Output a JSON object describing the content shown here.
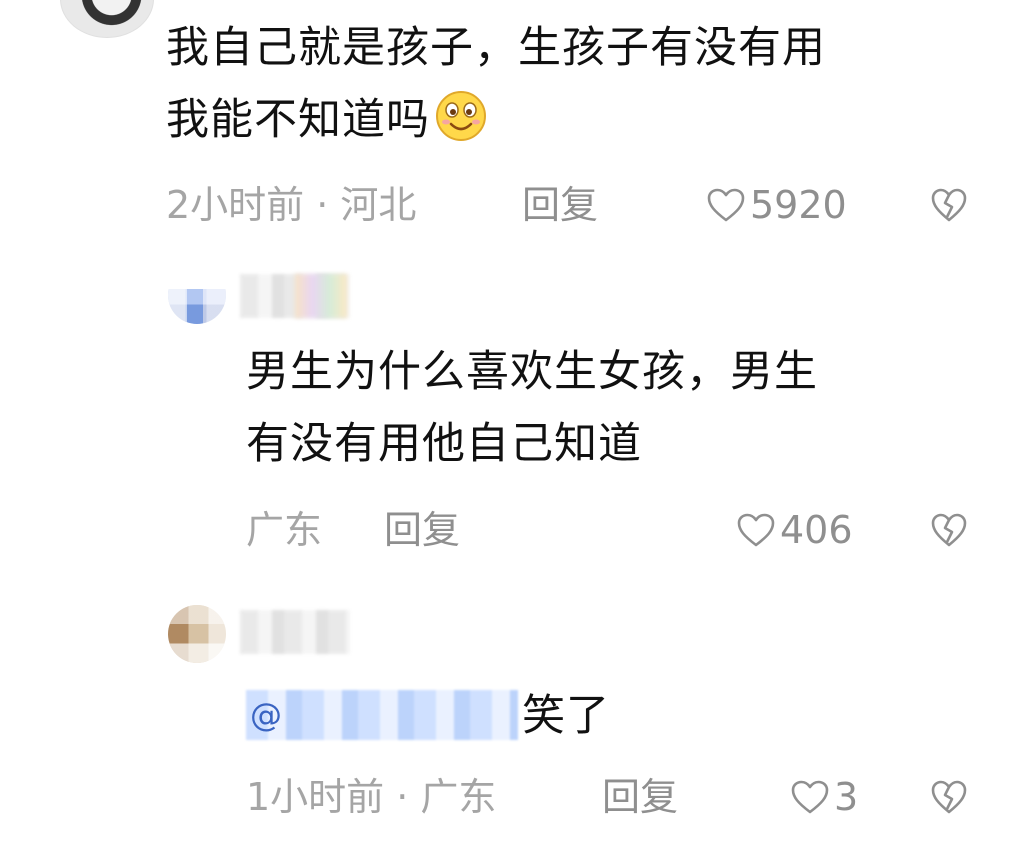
{
  "main_comment": {
    "text_line1": "我自己就是孩子，生孩子有没有用",
    "text_line2": "我能不知道吗",
    "emoji": "smile-emoji",
    "meta": "2小时前 · 河北",
    "reply_label": "回复",
    "likes": "5920"
  },
  "reply1": {
    "text_line1": "男生为什么喜欢生女孩，男生",
    "text_line2": "有没有用他自己知道",
    "location": "广东",
    "reply_label": "回复",
    "likes": "406"
  },
  "reply2": {
    "mention": "@",
    "text": "笑了",
    "meta": "1小时前 · 广东",
    "reply_label": "回复",
    "likes": "3"
  },
  "icons": {
    "like": "heart-outline-icon",
    "dislike": "broken-heart-icon"
  },
  "colors": {
    "text": "#111111",
    "meta": "#a5a5a5",
    "mention": "#3a64c2"
  }
}
